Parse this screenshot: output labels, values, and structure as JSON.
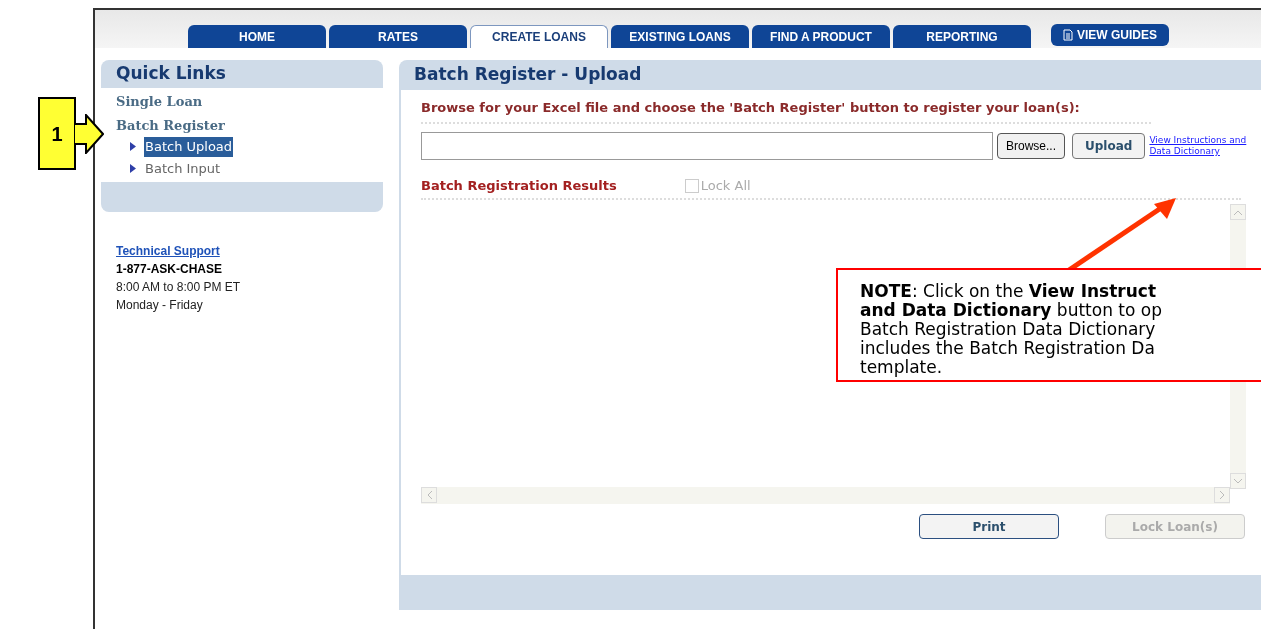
{
  "callout_marker": {
    "label": "1"
  },
  "tabs": [
    {
      "label": "HOME",
      "selected": false
    },
    {
      "label": "RATES",
      "selected": false
    },
    {
      "label": "CREATE LOANS",
      "selected": true
    },
    {
      "label": "EXISTING LOANS",
      "selected": false
    },
    {
      "label": "FIND A PRODUCT",
      "selected": false
    },
    {
      "label": "REPORTING",
      "selected": false
    }
  ],
  "guides_button": {
    "label": "VIEW GUIDES"
  },
  "quick_links": {
    "title": "Quick Links",
    "items": [
      {
        "label": "Single Loan"
      },
      {
        "label": "Batch Register",
        "children": [
          {
            "label": "Batch Upload",
            "selected": true
          },
          {
            "label": "Batch Input",
            "selected": false
          }
        ]
      }
    ]
  },
  "support": {
    "link": "Technical Support",
    "phone": "1-877-ASK-CHASE",
    "hours": "8:00 AM to 8:00 PM ET",
    "days": "Monday - Friday"
  },
  "main": {
    "title": "Batch Register - Upload",
    "instruction": "Browse for your Excel file and choose the 'Batch Register' button to register your loan(s):",
    "browse_button": "Browse...",
    "upload_button": "Upload",
    "instructions_link": [
      "View Instructions and",
      "Data Dictionary"
    ],
    "results_title": "Batch Registration Results",
    "lock_all": {
      "label": "Lock All",
      "checked": false,
      "disabled": true
    },
    "print_button": {
      "label": "Print",
      "disabled": false
    },
    "lock_button": {
      "label": "Lock Loan(s)",
      "disabled": true
    }
  },
  "note": {
    "lines": [
      "**NOTE**: Click on the **View Instruct**",
      "**and Data Dictionary** button to op",
      "Batch Registration Data Dictionary",
      "includes the Batch Registration Da",
      "template."
    ]
  }
}
